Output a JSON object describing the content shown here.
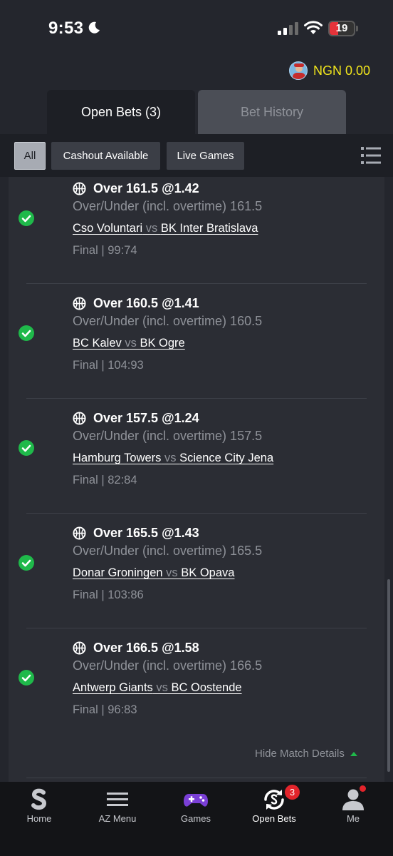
{
  "status_bar": {
    "time": "9:53",
    "battery": "19"
  },
  "header": {
    "balance": "NGN 0.00"
  },
  "tabs": [
    {
      "label": "Open Bets (3)",
      "active": true
    },
    {
      "label": "Bet History",
      "active": false
    }
  ],
  "filters": [
    {
      "label": "All",
      "selected": true
    },
    {
      "label": "Cashout Available",
      "selected": false
    },
    {
      "label": "Live Games",
      "selected": false
    }
  ],
  "bets": [
    {
      "title": "Over 161.5 @1.42",
      "market": "Over/Under (incl. overtime) 161.5",
      "home": "Cso Voluntari",
      "vs": " vs ",
      "away": "BK Inter Bratislava",
      "result": "Final | 99:74",
      "status": "won"
    },
    {
      "title": "Over 160.5 @1.41",
      "market": "Over/Under (incl. overtime) 160.5",
      "home": "BC Kalev",
      "vs": " vs ",
      "away": "BK Ogre",
      "result": "Final | 104:93",
      "status": "won"
    },
    {
      "title": "Over 157.5 @1.24",
      "market": "Over/Under (incl. overtime) 157.5",
      "home": "Hamburg Towers",
      "vs": " vs ",
      "away": "Science City Jena",
      "result": "Final | 82:84",
      "status": "won"
    },
    {
      "title": "Over 165.5 @1.43",
      "market": "Over/Under (incl. overtime) 165.5",
      "home": "Donar Groningen",
      "vs": " vs ",
      "away": "BK Opava",
      "result": "Final | 103:86",
      "status": "won"
    },
    {
      "title": "Over 166.5 @1.58",
      "market": "Over/Under (incl. overtime) 166.5",
      "home": "Antwerp Giants",
      "vs": " vs ",
      "away": "BC Oostende",
      "result": "Final | 96:83",
      "status": "won"
    }
  ],
  "hide_details": "Hide Match Details",
  "nav": [
    {
      "label": "Home",
      "icon": "sportybet-logo-icon"
    },
    {
      "label": "AZ Menu",
      "icon": "hamburger-menu-icon"
    },
    {
      "label": "Games",
      "icon": "gamepad-icon"
    },
    {
      "label": "Open Bets",
      "icon": "open-bets-icon",
      "badge": "3",
      "active": true
    },
    {
      "label": "Me",
      "icon": "user-icon"
    }
  ],
  "colors": {
    "accent_green": "#1fb94a",
    "balance_yellow": "#f2e61c",
    "badge_red": "#e3242b"
  }
}
